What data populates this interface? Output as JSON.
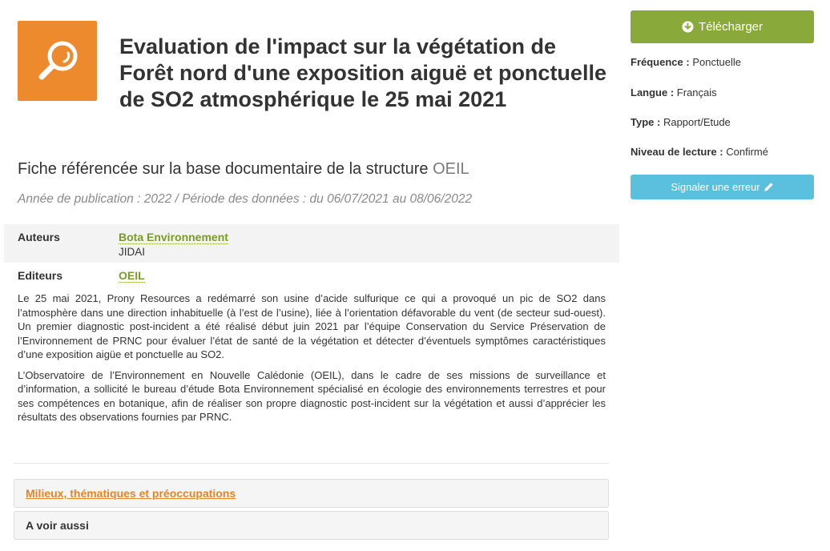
{
  "document": {
    "icon": "search-icon",
    "title": "Evaluation de l'impact sur la végétation de Forêt nord d'une exposition aiguë et ponctuelle de SO2 atmosphérique le 25 mai 2021",
    "subtitle_prefix": "Fiche référencée sur la base documentaire de la structure",
    "subtitle_structure": "OEIL",
    "publication_info": "Année de publication : 2022 / Période des données : du 06/07/2021 au 08/06/2022"
  },
  "meta": {
    "authors_label": "Auteurs",
    "authors": [
      "Bota Environnement",
      "JIDAI"
    ],
    "editors_label": "Editeurs",
    "editors": [
      "OEIL"
    ]
  },
  "summary": {
    "paragraphs": [
      "Le 25 mai 2021, Prony Resources a redémarré son usine d’acide sulfurique ce qui a provoqué un pic de SO2 dans l’atmosphère dans une direction inhabituelle (à l’est de l’usine), liée à l’orientation défavorable du vent (de secteur sud-ouest). Un premier diagnostic post-incident a été réalisé début juin 2021 par l’équipe Conservation du Service Préservation de l’Environnement de PRNC pour évaluer l’état de santé de la végétation et détecter d’éventuels symptômes caractéristiques d’une exposition aigüe et ponctuelle au SO2.",
      "L’Observatoire de l’Environnement en Nouvelle Calédonie (OEIL), dans le cadre de ses missions de surveillance et d’information, a sollicité le bureau d’étude Bota Environnement spécialisé en écologie des environnements terrestres et pour ses compétences en botanique, afin de réaliser son propre diagnostic post-incident sur la végétation et aussi d’apprécier les résultats des observations fournies par PRNC."
    ]
  },
  "panels": {
    "themes_label": "Milieux, thématiques et préoccupations",
    "see_also_label": "A voir aussi"
  },
  "sidebar": {
    "download_label": "Télécharger",
    "download_icon": "download-circle-icon",
    "frequency_label": "Fréquence :",
    "frequency_value": "Ponctuelle",
    "language_label": "Langue :",
    "language_value": "Français",
    "type_label": "Type :",
    "type_value": "Rapport/Etude",
    "reading_label": "Niveau de lecture :",
    "reading_value": "Confirmé",
    "report_error_label": "Signaler une erreur",
    "report_error_icon": "pencil-icon"
  },
  "colors": {
    "icon_tile": "#ec8a2d",
    "download_button": "#8aa93b",
    "report_button": "#5bc0de",
    "link_green": "#7a9a2a",
    "link_orange": "#e3852b"
  }
}
